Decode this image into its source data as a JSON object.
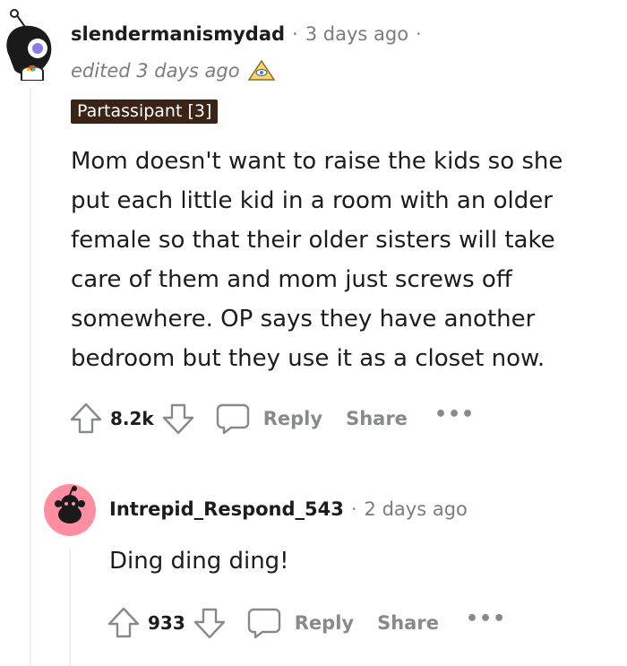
{
  "comment1": {
    "username": "slendermanismydad",
    "time": "3 days ago",
    "edited": "edited 3 days ago",
    "flair": "Partassipant [3]",
    "body": "Mom doesn't want to raise the kids so she put each little kid in a room with an older female so that their older sisters will take care of them and mom just screws off somewhere. OP says they have another bedroom but they use it as a closet now.",
    "score": "8.2k",
    "reply_label": "Reply",
    "share_label": "Share",
    "more_label": "•••"
  },
  "comment2": {
    "username": "Intrepid_Respond_543",
    "time": "2 days ago",
    "body": "Ding ding ding!",
    "score": "933",
    "reply_label": "Reply",
    "share_label": "Share",
    "more_label": "•••"
  },
  "separator": "·",
  "colors": {
    "flair_bg": "#3b2416",
    "avatar2_bg": "#ff8fa0",
    "muted": "#878a8c"
  }
}
